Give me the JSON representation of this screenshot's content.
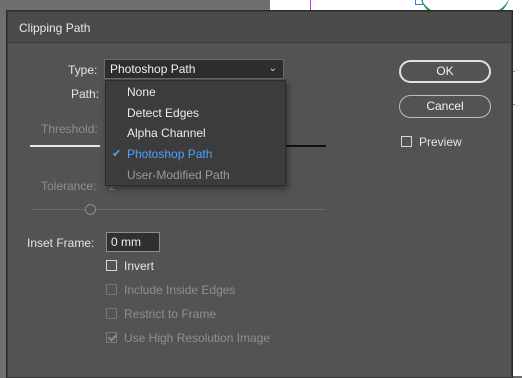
{
  "dialog": {
    "title": "Clipping Path"
  },
  "type_field": {
    "label": "Type:",
    "value": "Photoshop Path"
  },
  "path_field": {
    "label": "Path:"
  },
  "dropdown": {
    "options": [
      "None",
      "Detect Edges",
      "Alpha Channel",
      "Photoshop Path",
      "User-Modified Path"
    ],
    "selected": "Photoshop Path"
  },
  "threshold": {
    "label": "Threshold:"
  },
  "tolerance": {
    "label": "Tolerance:",
    "value": "2"
  },
  "inset_frame": {
    "label": "Inset Frame:",
    "value": "0 mm"
  },
  "buttons": {
    "ok": "OK",
    "cancel": "Cancel"
  },
  "preview": {
    "label": "Preview",
    "checked": false
  },
  "checkboxes": {
    "invert": {
      "label": "Invert",
      "checked": false,
      "enabled": true
    },
    "include_inside_edges": {
      "label": "Include Inside Edges",
      "checked": false,
      "enabled": false
    },
    "restrict_to_frame": {
      "label": "Restrict to Frame",
      "checked": false,
      "enabled": false
    },
    "use_high_resolution": {
      "label": "Use High Resolution Image",
      "checked": true,
      "enabled": false
    }
  },
  "colors": {
    "dialog_bg": "#535353",
    "selected_item": "#4aa3ff",
    "disabled_text": "#8f8f8f"
  }
}
